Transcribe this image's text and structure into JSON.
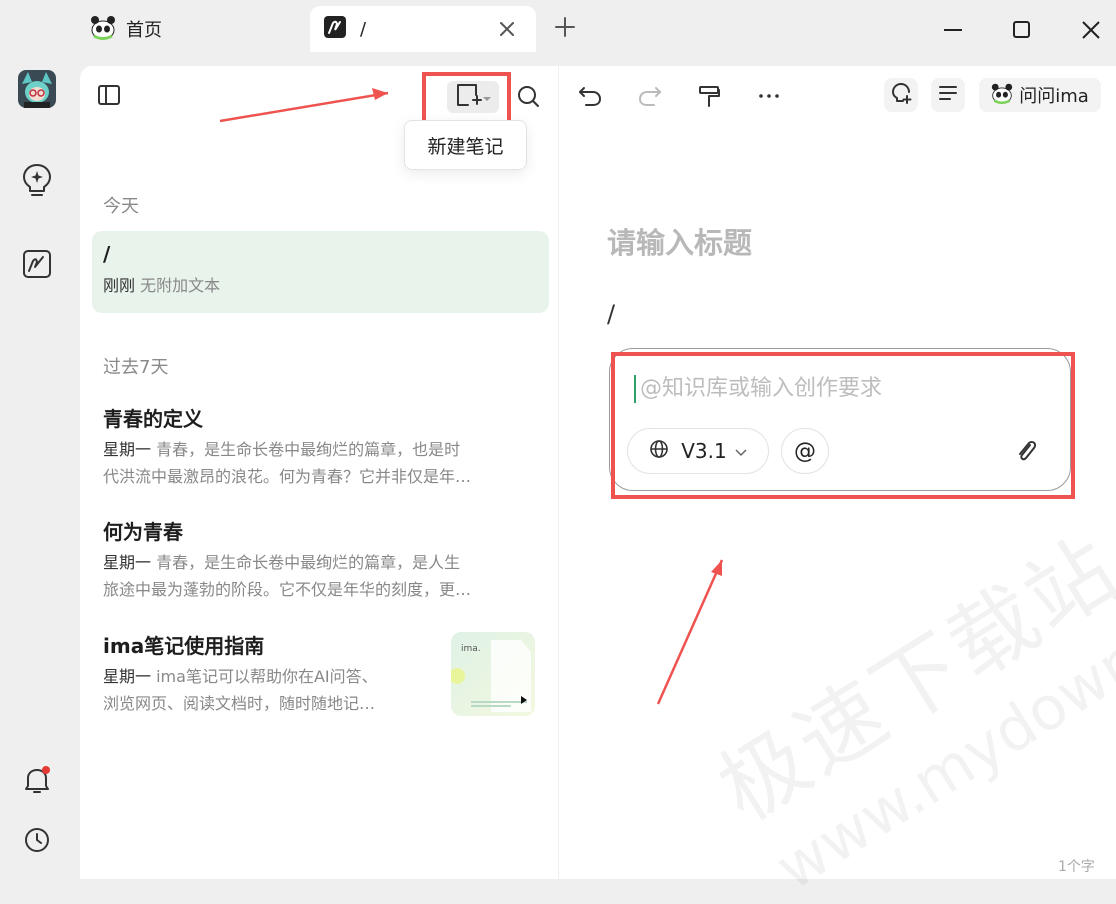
{
  "tabs": [
    {
      "label": "首页",
      "icon": "panda-icon"
    },
    {
      "label": "/",
      "icon": "note-app-icon"
    }
  ],
  "tooltip": "新建笔记",
  "sections": {
    "today": "今天",
    "past7": "过去7天"
  },
  "notes_today": [
    {
      "title": "/",
      "day": "刚刚",
      "snippet": "无附加文本"
    }
  ],
  "notes_past": [
    {
      "title": "青春的定义",
      "day": "星期一",
      "line1": "青春，是生命长卷中最绚烂的篇章，也是时",
      "line2": "代洪流中最激昂的浪花。何为青春？它并非仅是年…"
    },
    {
      "title": "何为青春",
      "day": "星期一",
      "line1": "青春，是生命长卷中最绚烂的篇章，是人生",
      "line2": "旅途中最为蓬勃的阶段。它不仅是年华的刻度，更…"
    },
    {
      "title": "ima笔记使用指南",
      "day": "星期一",
      "line1": "ima笔记可以帮助你在AI问答、",
      "line2": "浏览网页、阅读文档时，随时随地记…",
      "thumb_text": "ima."
    }
  ],
  "editor": {
    "title_placeholder": "请输入标题",
    "body_text": "/",
    "ai_placeholder": "@知识库或输入创作要求",
    "model_label": "V3.1",
    "at_label": "@",
    "ask_button": "问问ima",
    "char_count": "1个字"
  },
  "watermark": {
    "line1": "极速下载站",
    "line2": "www.mydown.com"
  },
  "colors": {
    "accent": "#2e9e6a",
    "highlight": "#ef5350",
    "selected_bg": "#e8f3ec"
  }
}
